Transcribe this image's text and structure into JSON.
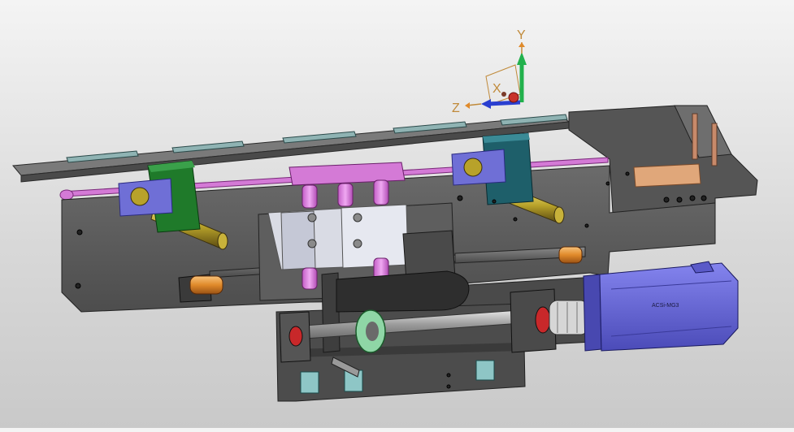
{
  "viewport": {
    "background_top": "#f4f4f4",
    "background_bottom": "#c9c9c9"
  },
  "triad": {
    "x_label": "X",
    "y_label": "Y",
    "z_label": "Z",
    "x_color": "#c8322a",
    "y_color": "#22b14c",
    "z_color": "#2a3fd0"
  },
  "model": {
    "motor_label": "ACSi-MG3",
    "colors": {
      "frame": "#5a5a5a",
      "frame_dark": "#3e3e3e",
      "green_block": "#1f7a2a",
      "teal_block": "#1e5f6a",
      "blue_block": "#6f6fd6",
      "pink": "#d47ad6",
      "orange": "#e08a2a",
      "motor": "#6a6ad8",
      "shaft": "#a8a8a8",
      "tan_plate": "#e0a77a"
    }
  }
}
